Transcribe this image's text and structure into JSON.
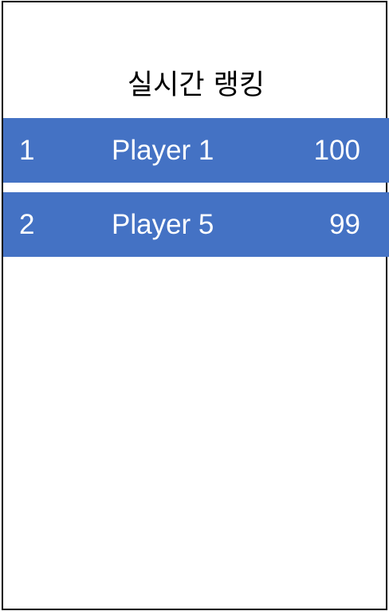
{
  "header": {
    "title": "실시간 랭킹"
  },
  "ranking": {
    "rows": [
      {
        "rank": "1",
        "name": "Player 1",
        "score": "100"
      },
      {
        "rank": "2",
        "name": "Player 5",
        "score": "99"
      }
    ]
  },
  "colors": {
    "row_background": "#4472c4",
    "row_text": "#ffffff",
    "border": "#000000"
  }
}
